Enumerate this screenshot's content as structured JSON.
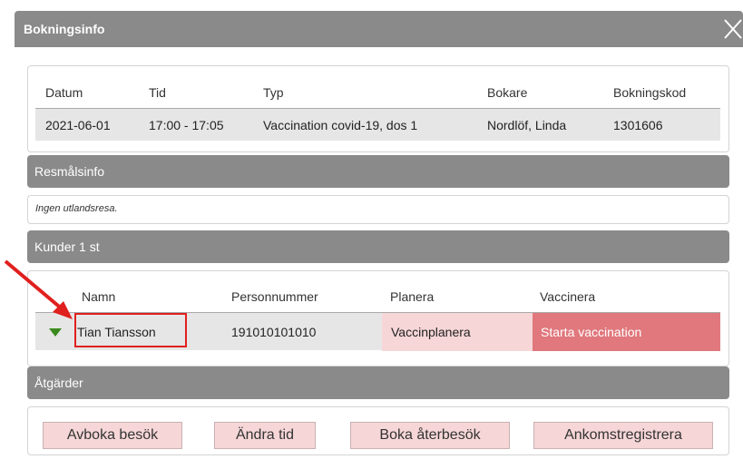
{
  "dialog": {
    "title": "Bokningsinfo"
  },
  "booking": {
    "headers": [
      "Datum",
      "Tid",
      "Typ",
      "Bokare",
      "Bokningskod"
    ],
    "row": [
      "2021-06-01",
      "17:00 - 17:05",
      "Vaccination covid-19, dos 1",
      "Nordlöf, Linda",
      "1301606"
    ]
  },
  "travel": {
    "header": "Resmålsinfo",
    "note": "Ingen utlandsresa."
  },
  "customers": {
    "header": "Kunder 1 st",
    "columns": [
      "Namn",
      "Personnummer",
      "Planera",
      "Vaccinera"
    ],
    "row": {
      "name": "Tian Tiansson",
      "personnummer": "191010101010",
      "planera": "Vaccinplanera",
      "vaccinera": "Starta vaccination"
    }
  },
  "actions": {
    "header": "Åtgärder",
    "buttons": [
      "Avboka besök",
      "Ändra tid",
      "Boka återbesök",
      "Ankomstregistrera"
    ]
  },
  "colors": {
    "header_gray": "#8a8a8a",
    "pink": "#f6d6d7",
    "red": "#e0787d",
    "annotation_red": "#e0201e",
    "expand_green": "#3a8a1e"
  }
}
